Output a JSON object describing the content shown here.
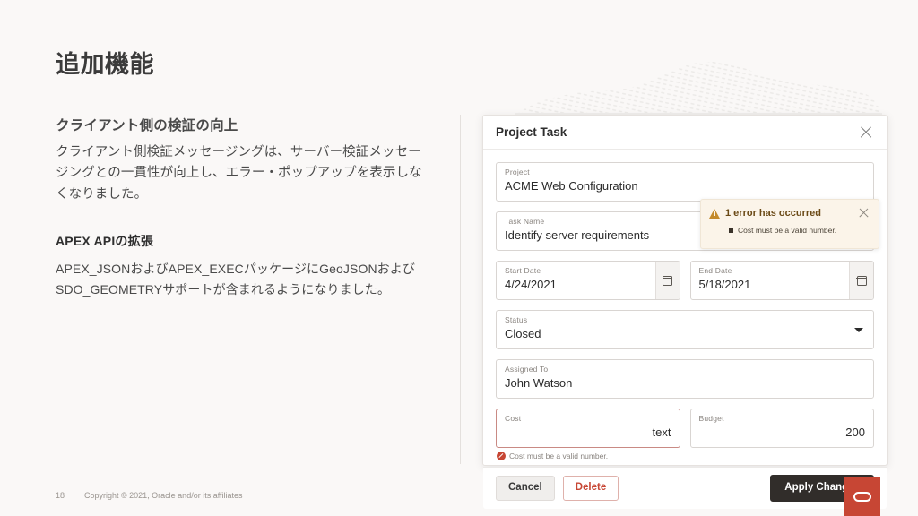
{
  "slide": {
    "title": "追加機能",
    "page_number": "18",
    "copyright": "Copyright © 2021, Oracle and/or its affiliates",
    "logo_name": "oracle-logo",
    "background": "#faf8f7",
    "accent": "#c74634"
  },
  "content": {
    "sections": [
      {
        "heading": "クライアント側の検証の向上",
        "body": "クライアント側検証メッセージングは、サーバー検証メッセージングとの一貫性が向上し、エラー・ポップアップを表示しなくなりました。"
      },
      {
        "heading": "APEX APIの拡張",
        "body": "APEX_JSONおよびAPEX_EXECパッケージにGeoJSONおよびSDO_GEOMETRYサポートが含まれるようになりました。"
      }
    ]
  },
  "dialog": {
    "title": "Project Task",
    "close_icon": "close-icon",
    "fields": {
      "project": {
        "label": "Project",
        "value": "ACME Web Configuration"
      },
      "task_name": {
        "label": "Task Name",
        "value": "Identify server requirements"
      },
      "start_date": {
        "label": "Start Date",
        "value": "4/24/2021",
        "icon": "calendar-icon"
      },
      "end_date": {
        "label": "End Date",
        "value": "5/18/2021",
        "icon": "calendar-icon"
      },
      "status": {
        "label": "Status",
        "value": "Closed",
        "icon": "chevron-down-icon"
      },
      "assigned_to": {
        "label": "Assigned To",
        "value": "John Watson"
      },
      "cost": {
        "label": "Cost",
        "value": "text",
        "error": "Cost must be a valid number.",
        "error_color": "#c74634"
      },
      "budget": {
        "label": "Budget",
        "value": "200"
      }
    },
    "notification": {
      "title": "1 error has occurred",
      "item": "Cost must be a valid number.",
      "icon": "warning-triangle-icon",
      "close_icon": "close-icon",
      "background": "#fbf4e9"
    },
    "footer": {
      "cancel_label": "Cancel",
      "delete_label": "Delete",
      "apply_label": "Apply Changes",
      "apply_color": "#312d2a",
      "delete_color": "#c74634"
    }
  }
}
